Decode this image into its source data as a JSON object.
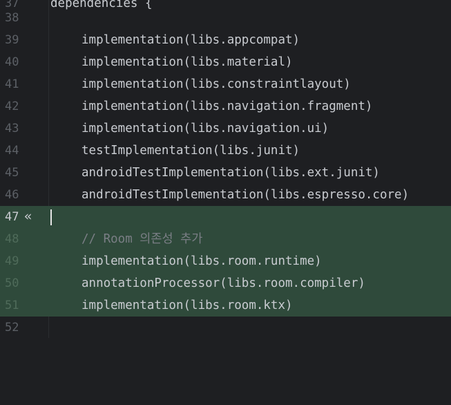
{
  "lines": [
    {
      "num": "37",
      "text": "dependencies {"
    },
    {
      "num": "38",
      "text": ""
    },
    {
      "num": "39",
      "text": "implementation(libs.appcompat)"
    },
    {
      "num": "40",
      "text": "implementation(libs.material)"
    },
    {
      "num": "41",
      "text": "implementation(libs.constraintlayout)"
    },
    {
      "num": "42",
      "text": "implementation(libs.navigation.fragment)"
    },
    {
      "num": "43",
      "text": "implementation(libs.navigation.ui)"
    },
    {
      "num": "44",
      "text": "testImplementation(libs.junit)"
    },
    {
      "num": "45",
      "text": "androidTestImplementation(libs.ext.junit)"
    },
    {
      "num": "46",
      "text": "androidTestImplementation(libs.espresso.core)"
    },
    {
      "num": "47",
      "text": ""
    },
    {
      "num": "48",
      "text": "// Room 의존성 추가"
    },
    {
      "num": "49",
      "text": "implementation(libs.room.runtime)"
    },
    {
      "num": "50",
      "text": "annotationProcessor(libs.room.compiler)"
    },
    {
      "num": "51",
      "text": "implementation(libs.room.ktx)"
    },
    {
      "num": "52",
      "text": ""
    }
  ],
  "gutter": {
    "fold_icon": "«",
    "fold_icon_name": "chevrons-left-icon"
  },
  "colors": {
    "background": "#1e1f22",
    "changed_highlight": "#2f4a3b",
    "code_text": "#c9ccd1",
    "comment_text": "#7a7e85",
    "line_number": "#5c6066"
  }
}
